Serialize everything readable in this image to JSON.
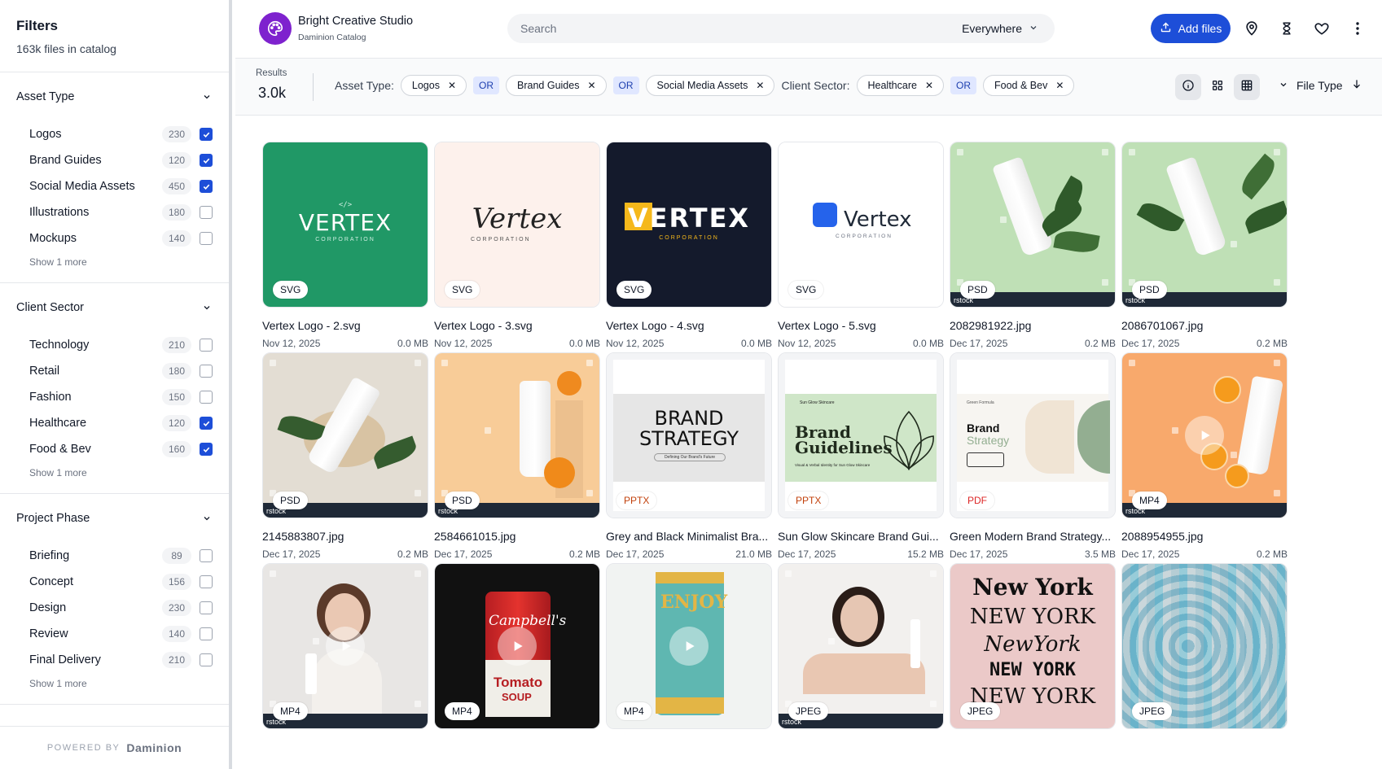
{
  "sidebar": {
    "title": "Filters",
    "subtitle": "163k files in catalog",
    "groups": [
      {
        "title": "Asset Type",
        "items": [
          {
            "label": "Logos",
            "count": "230",
            "checked": true
          },
          {
            "label": "Brand Guides",
            "count": "120",
            "checked": true
          },
          {
            "label": "Social Media Assets",
            "count": "450",
            "checked": true
          },
          {
            "label": "Illustrations",
            "count": "180",
            "checked": false
          },
          {
            "label": "Mockups",
            "count": "140",
            "checked": false
          }
        ],
        "show_more": "Show 1 more"
      },
      {
        "title": "Client Sector",
        "items": [
          {
            "label": "Technology",
            "count": "210",
            "checked": false
          },
          {
            "label": "Retail",
            "count": "180",
            "checked": false
          },
          {
            "label": "Fashion",
            "count": "150",
            "checked": false
          },
          {
            "label": "Healthcare",
            "count": "120",
            "checked": true
          },
          {
            "label": "Food & Bev",
            "count": "160",
            "checked": true
          }
        ],
        "show_more": "Show 1 more"
      },
      {
        "title": "Project Phase",
        "items": [
          {
            "label": "Briefing",
            "count": "89",
            "checked": false
          },
          {
            "label": "Concept",
            "count": "156",
            "checked": false
          },
          {
            "label": "Design",
            "count": "230",
            "checked": false
          },
          {
            "label": "Review",
            "count": "140",
            "checked": false
          },
          {
            "label": "Final Delivery",
            "count": "210",
            "checked": false
          }
        ],
        "show_more": "Show 1 more"
      }
    ],
    "powered_by": "POWERED BY",
    "powered_brand": "Daminion"
  },
  "header": {
    "app_name": "Bright Creative Studio",
    "app_sub": "Daminion Catalog",
    "search_placeholder": "Search",
    "scope": "Everywhere",
    "add_files": "Add files"
  },
  "filter_bar": {
    "results_label": "Results",
    "results_value": "3.0k",
    "asset_type_label": "Asset Type:",
    "asset_chips": [
      "Logos",
      "Brand Guides",
      "Social Media Assets"
    ],
    "sector_label": "Client Sector:",
    "sector_chips": [
      "Healthcare",
      "Food & Bev"
    ],
    "or_label": "OR",
    "sort_label": "File Type"
  },
  "assets": [
    {
      "name": "Vertex Logo - 2.svg",
      "date": "Nov 12, 2025",
      "size": "0.0 MB",
      "type": "SVG"
    },
    {
      "name": "Vertex Logo - 3.svg",
      "date": "Nov 12, 2025",
      "size": "0.0 MB",
      "type": "SVG"
    },
    {
      "name": "Vertex Logo - 4.svg",
      "date": "Nov 12, 2025",
      "size": "0.0 MB",
      "type": "SVG"
    },
    {
      "name": "Vertex Logo - 5.svg",
      "date": "Nov 12, 2025",
      "size": "0.0 MB",
      "type": "SVG"
    },
    {
      "name": "2082981922.jpg",
      "date": "Dec 17, 2025",
      "size": "0.2 MB",
      "type": "PSD"
    },
    {
      "name": "2086701067.jpg",
      "date": "Dec 17, 2025",
      "size": "0.2 MB",
      "type": "PSD"
    },
    {
      "name": "2145883807.jpg",
      "date": "Dec 17, 2025",
      "size": "0.2 MB",
      "type": "PSD"
    },
    {
      "name": "2584661015.jpg",
      "date": "Dec 17, 2025",
      "size": "0.2 MB",
      "type": "PSD"
    },
    {
      "name": "Grey and Black Minimalist Bra...",
      "date": "Dec 17, 2025",
      "size": "21.0 MB",
      "type": "PPTX"
    },
    {
      "name": "Sun Glow Skincare Brand Gui...",
      "date": "Dec 17, 2025",
      "size": "15.2 MB",
      "type": "PPTX"
    },
    {
      "name": "Green Modern Brand Strategy...",
      "date": "Dec 17, 2025",
      "size": "3.5 MB",
      "type": "PDF"
    },
    {
      "name": "2088954955.jpg",
      "date": "Dec 17, 2025",
      "size": "0.2 MB",
      "type": "MP4"
    },
    {
      "type": "MP4"
    },
    {
      "type": "MP4"
    },
    {
      "type": "MP4"
    },
    {
      "type": "JPEG"
    },
    {
      "type": "JPEG"
    },
    {
      "type": "JPEG"
    }
  ],
  "thumb_text": {
    "vertex2_tag": "</>",
    "vertex2_word": "VERTEX",
    "vertex2_corp": "CORPORATION",
    "vertex3_word": "Vertex",
    "vertex3_corp": "CORPORATION",
    "vertex4_word": "VERTEX",
    "vertex4_corp": "CORPORATION",
    "vertex5_word": "Vertex",
    "vertex5_corp": "CORPORATION",
    "brand_strategy_l1": "BRAND",
    "brand_strategy_l2": "STRATEGY",
    "brand_strategy_sub": "Defining Our Brand's Future",
    "sunglow_brand": "Sun Glow Skincare",
    "sunglow_l1": "Brand",
    "sunglow_l2": "Guidelines",
    "sunglow_sub": "Visual & Verbal Identity for Sun Glow Skincare",
    "green_l1": "Brand",
    "green_l2": "Strategy",
    "green_top": "Green Formula",
    "stock": "rstock",
    "campbells": "Campbell's",
    "tomato": "Tomato",
    "soup": "SOUP",
    "enjoy": "ENJOY",
    "ny1": "New York",
    "ny2": "NEW YORK",
    "ny3": "NewYork",
    "ny4": "NEW YORK",
    "ny5": "NEW YORK"
  },
  "colors": {
    "primary": "#1d4ed8",
    "brand_logo": "#7e22ce",
    "or_bg": "#e0e7ff"
  }
}
